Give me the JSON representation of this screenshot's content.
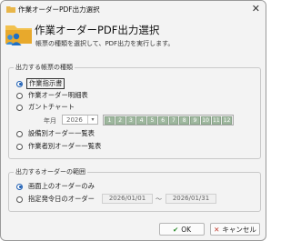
{
  "window": {
    "title": "作業オーダーPDF出力選択",
    "close_glyph": "✕"
  },
  "header": {
    "title": "作業オーダーPDF出力選択",
    "description": "帳票の種類を選択して、PDF出力を実行します。"
  },
  "report_type_group": {
    "legend": "出力する帳票の種類",
    "options": [
      {
        "label": "作業指示書",
        "selected": true
      },
      {
        "label": "作業オーダー明細表",
        "selected": false
      },
      {
        "label": "ガントチャート",
        "selected": false
      },
      {
        "label": "設備別オーダー一覧表",
        "selected": false
      },
      {
        "label": "作業者別オーダー一覧表",
        "selected": false
      }
    ],
    "year_month_label": "年月",
    "year_value": "2026",
    "months": [
      "1",
      "2",
      "3",
      "4",
      "5",
      "6",
      "7",
      "8",
      "9",
      "10",
      "11",
      "12"
    ]
  },
  "range_group": {
    "legend": "出力するオーダーの範囲",
    "options": [
      {
        "label": "画面上のオーダーのみ",
        "selected": true
      },
      {
        "label": "指定発令日のオーダー",
        "selected": false
      }
    ],
    "date_from": "2026/01/01",
    "date_separator": "～",
    "date_to": "2026/01/31"
  },
  "buttons": {
    "ok_label": "OK",
    "cancel_label": "キャンセル"
  },
  "colors": {
    "accent": "#1e5fb4",
    "month_fill": "#9fb89f",
    "ok_check": "#2a8a2a",
    "cancel_x": "#c0392b"
  }
}
